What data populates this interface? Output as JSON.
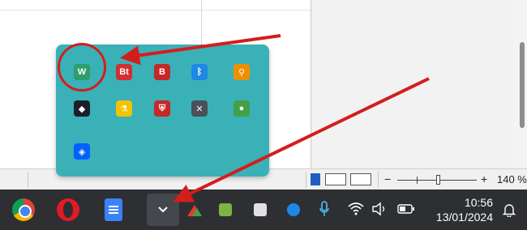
{
  "statusbar": {
    "zoom_minus": "−",
    "zoom_plus": "+",
    "zoom_label": "140 %"
  },
  "taskbar": {
    "pinned": [
      {
        "name": "chrome",
        "icon": "chrome-icon"
      },
      {
        "name": "opera",
        "icon": "opera-icon"
      },
      {
        "name": "docs",
        "icon": "docs-icon"
      }
    ],
    "overflow_chevron": "⌄",
    "tray_glyphs": {
      "mic": "🎙",
      "wifi": "⌔",
      "volume": "🔈",
      "battery": "▭",
      "notification": "🔔"
    },
    "clock": {
      "time": "10:56",
      "date": "13/01/2024"
    }
  },
  "flyout": {
    "icons": [
      {
        "name": "wps-icon",
        "label": "W",
        "color": "#2e9e6a"
      },
      {
        "name": "bt-app-icon",
        "label": "Bt",
        "color": "#d32f2f"
      },
      {
        "name": "b-app-icon",
        "label": "B",
        "color": "#c62828"
      },
      {
        "name": "bluetooth-icon",
        "label": "ᛒ",
        "color": "#1e88e5"
      },
      {
        "name": "search-tool-icon",
        "label": "⚲",
        "color": "#ef8f00"
      },
      {
        "name": "hex-app-icon",
        "label": "◆",
        "color": "#1b1f2a"
      },
      {
        "name": "flask-icon",
        "label": "⚗",
        "color": "#f2c300"
      },
      {
        "name": "shield-icon",
        "label": "⛨",
        "color": "#c62828"
      },
      {
        "name": "hat-app-icon",
        "label": "✕",
        "color": "#4a4f58"
      },
      {
        "name": "mic-app-icon",
        "label": "●",
        "color": "#43a047"
      },
      {
        "name": "dropbox-icon",
        "label": "◈",
        "color": "#0061ff"
      }
    ]
  },
  "colors": {
    "flyout_bg": "#3ab0b7",
    "taskbar_bg": "#2d2f33",
    "annotation_red": "#d41d1d"
  }
}
